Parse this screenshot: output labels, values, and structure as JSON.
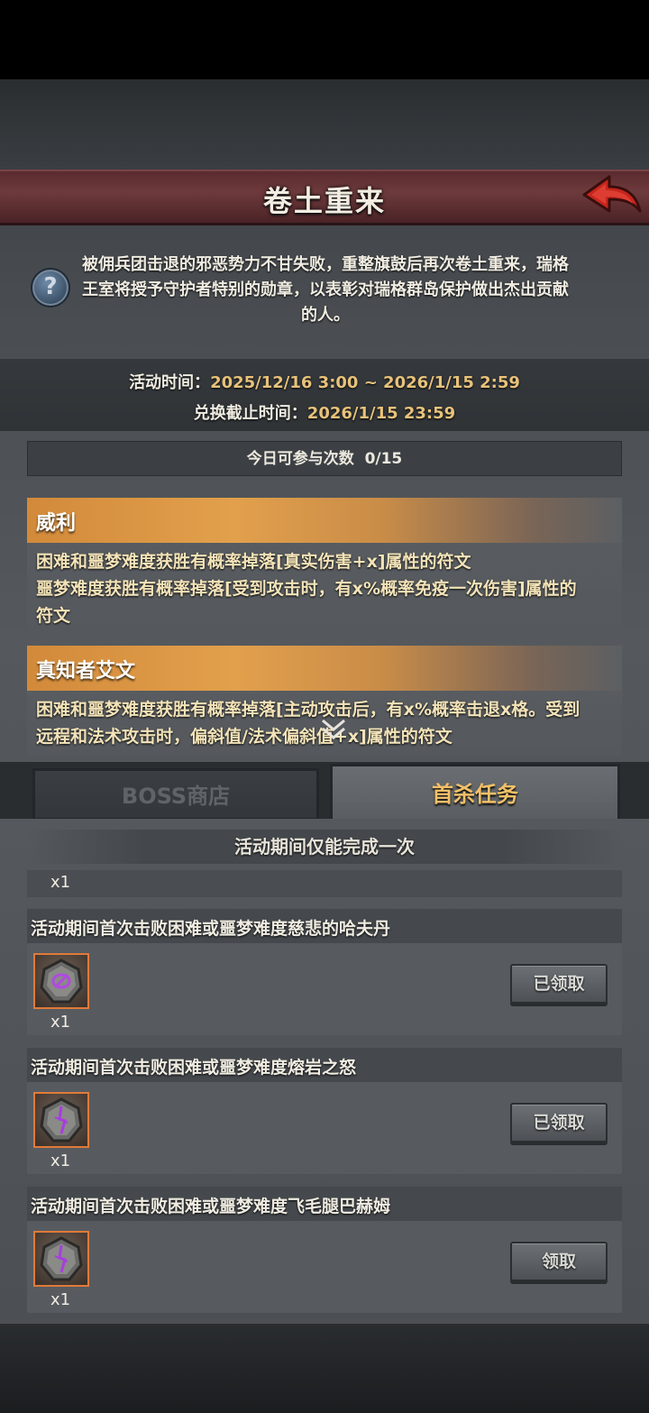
{
  "header": {
    "title": "卷土重来"
  },
  "description": {
    "help_icon": "?",
    "text": "被佣兵团击退的邪恶势力不甘失败，重整旗鼓后再次卷土重来，瑞格王室将授予守护者特别的勋章，以表彰对瑞格群岛保护做出杰出贡献的人。"
  },
  "times": {
    "activity_label": "活动时间：",
    "activity_value": "2025/12/16 3:00 ~ 2026/1/15 2:59",
    "exchange_label": "兑换截止时间：",
    "exchange_value": "2026/1/15 23:59"
  },
  "daily": {
    "label": "今日可参与次数",
    "value": "0/15"
  },
  "bosses": [
    {
      "name": "威利",
      "desc_lines": [
        "困难和噩梦难度获胜有概率掉落[真实伤害+x]属性的符文",
        "噩梦难度获胜有概率掉落[受到攻击时，有x%概率免疫一次伤害]属性的",
        "符文"
      ]
    },
    {
      "name": "真知者艾文",
      "desc_lines": [
        "困难和噩梦难度获胜有概率掉落[主动攻击后，有x%概率击退x格。受到",
        "远程和法术攻击时，偏斜值/法术偏斜值+x]属性的符文"
      ]
    }
  ],
  "tabs": {
    "boss_shop": "BOSS商店",
    "first_kill": "首杀任务"
  },
  "once_banner": "活动期间仅能完成一次",
  "stray_qty": "x1",
  "tasks": [
    {
      "title": "活动期间首次击败困难或噩梦难度慈悲的哈夫丹",
      "qty": "x1",
      "button": "已领取",
      "rune_color": "#b04ae0"
    },
    {
      "title": "活动期间首次击败困难或噩梦难度熔岩之怒",
      "qty": "x1",
      "button": "已领取",
      "rune_color": "#a83ce0"
    },
    {
      "title": "活动期间首次击败困难或噩梦难度飞毛腿巴赫姆",
      "qty": "x1",
      "button": "领取",
      "rune_color": "#a83ce0"
    }
  ]
}
